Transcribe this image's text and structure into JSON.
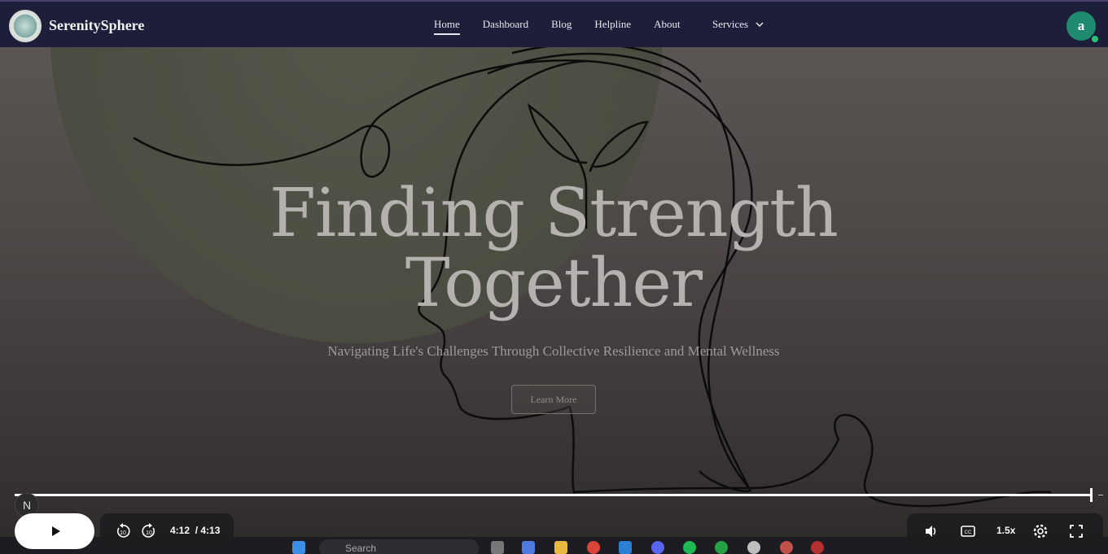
{
  "navbar": {
    "brand": "SerenitySphere",
    "links": [
      "Home",
      "Dashboard",
      "Blog",
      "Helpline",
      "About"
    ],
    "active": "Home",
    "services_label": "Services",
    "avatar_initial": "a"
  },
  "hero": {
    "title_line1": "Finding Strength",
    "title_line2": "Together",
    "subtitle": "Navigating Life's Challenges Through Collective Resilience and Mental Wellness",
    "cta_label": "Learn More"
  },
  "player": {
    "badge": "N",
    "current_time": "4:12",
    "total_time": "/ 4:13",
    "progress": 0.996,
    "speed": "1.5x"
  },
  "taskbar": {
    "search_placeholder": "Search"
  },
  "colors": {
    "navbar_bg": "#1d1f3a",
    "avatar_bg": "#1f8a6e",
    "online_dot": "#2ec27e"
  }
}
